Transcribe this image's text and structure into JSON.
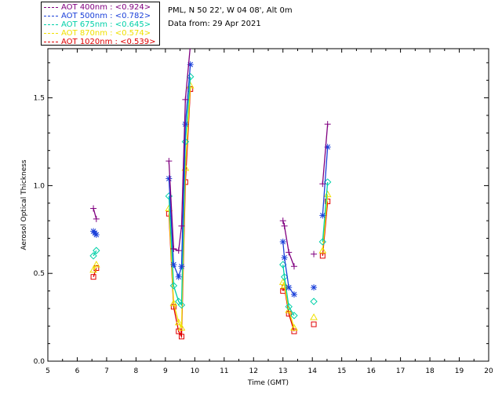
{
  "header": {
    "site": "PML, N 50 22', W 04 08', Alt 0m",
    "date": "Data from: 29 Apr 2021"
  },
  "legend": [
    {
      "label": "AOT  400nm : <0.924>",
      "color": "#800080"
    },
    {
      "label": "AOT  500nm : <0.782>",
      "color": "#1a3fd9"
    },
    {
      "label": "AOT  675nm : <0.645>",
      "color": "#00d0a8"
    },
    {
      "label": "AOT  870nm : <0.574>",
      "color": "#f0e000"
    },
    {
      "label": "AOT 1020nm : <0.539>",
      "color": "#e00000"
    }
  ],
  "chart_data": {
    "type": "line",
    "title": "",
    "xlabel": "Time (GMT)",
    "ylabel": "Aerosol Optical Thickness",
    "xlim": [
      5,
      20
    ],
    "ylim": [
      0,
      1.78
    ],
    "xticks": [
      "5",
      "6",
      "7",
      "8",
      "9",
      "10",
      "11",
      "12",
      "13",
      "14",
      "15",
      "16",
      "17",
      "18",
      "19",
      "20"
    ],
    "yticks": [
      "0.0",
      "0.5",
      "1.0",
      "1.5"
    ],
    "grid": false,
    "series": [
      {
        "name": "AOT  400nm : <0.924>",
        "color": "#800080",
        "marker": "plus",
        "segments": [
          [
            [
              6.55,
              0.87
            ],
            [
              6.65,
              0.81
            ]
          ],
          [
            [
              9.12,
              1.14
            ],
            [
              9.28,
              0.64
            ],
            [
              9.45,
              0.63
            ],
            [
              9.55,
              0.77
            ],
            [
              9.68,
              1.49
            ],
            [
              9.85,
              1.8
            ]
          ],
          [
            [
              13.0,
              0.8
            ],
            [
              13.05,
              0.77
            ],
            [
              13.2,
              0.62
            ],
            [
              13.38,
              0.54
            ]
          ],
          [
            [
              14.05,
              0.61
            ]
          ],
          [
            [
              14.35,
              1.01
            ],
            [
              14.52,
              1.35
            ]
          ]
        ]
      },
      {
        "name": "AOT  500nm : <0.782>",
        "color": "#1a3fd9",
        "marker": "star",
        "segments": [
          [
            [
              6.55,
              0.74
            ],
            [
              6.6,
              0.73
            ],
            [
              6.65,
              0.72
            ]
          ],
          [
            [
              9.12,
              1.04
            ],
            [
              9.28,
              0.55
            ],
            [
              9.45,
              0.48
            ],
            [
              9.55,
              0.54
            ],
            [
              9.68,
              1.35
            ],
            [
              9.85,
              1.69
            ]
          ],
          [
            [
              13.0,
              0.68
            ],
            [
              13.05,
              0.59
            ],
            [
              13.2,
              0.42
            ],
            [
              13.38,
              0.38
            ]
          ],
          [
            [
              14.05,
              0.42
            ]
          ],
          [
            [
              14.35,
              0.83
            ],
            [
              14.52,
              1.22
            ]
          ]
        ]
      },
      {
        "name": "AOT  675nm : <0.645>",
        "color": "#00d0a8",
        "marker": "diamond",
        "segments": [
          [
            [
              6.55,
              0.6
            ],
            [
              6.65,
              0.63
            ]
          ],
          [
            [
              9.12,
              0.94
            ],
            [
              9.28,
              0.43
            ],
            [
              9.45,
              0.34
            ],
            [
              9.55,
              0.32
            ],
            [
              9.68,
              1.25
            ],
            [
              9.85,
              1.62
            ]
          ],
          [
            [
              13.0,
              0.55
            ],
            [
              13.05,
              0.48
            ],
            [
              13.2,
              0.31
            ],
            [
              13.38,
              0.26
            ]
          ],
          [
            [
              14.05,
              0.34
            ]
          ],
          [
            [
              14.35,
              0.68
            ],
            [
              14.52,
              1.02
            ]
          ]
        ]
      },
      {
        "name": "AOT  870nm : <0.574>",
        "color": "#f0e000",
        "marker": "triangle",
        "segments": [
          [
            [
              6.55,
              0.52
            ],
            [
              6.65,
              0.55
            ]
          ],
          [
            [
              9.12,
              0.87
            ],
            [
              9.28,
              0.33
            ],
            [
              9.45,
              0.22
            ],
            [
              9.55,
              0.19
            ],
            [
              9.68,
              1.1
            ],
            [
              9.85,
              1.57
            ]
          ],
          [
            [
              13.0,
              0.45
            ],
            [
              13.05,
              0.43
            ],
            [
              13.2,
              0.29
            ],
            [
              13.38,
              0.19
            ]
          ],
          [
            [
              14.05,
              0.25
            ]
          ],
          [
            [
              14.35,
              0.63
            ],
            [
              14.52,
              0.95
            ]
          ]
        ]
      },
      {
        "name": "AOT 1020nm : <0.539>",
        "color": "#e00000",
        "marker": "square",
        "segments": [
          [
            [
              6.55,
              0.48
            ],
            [
              6.65,
              0.53
            ]
          ],
          [
            [
              9.12,
              0.84
            ],
            [
              9.28,
              0.31
            ],
            [
              9.45,
              0.17
            ],
            [
              9.55,
              0.14
            ],
            [
              9.68,
              1.02
            ],
            [
              9.85,
              1.55
            ]
          ],
          [
            [
              13.0,
              0.4
            ],
            [
              13.05,
              0.42
            ],
            [
              13.2,
              0.27
            ],
            [
              13.38,
              0.17
            ]
          ],
          [
            [
              14.05,
              0.21
            ]
          ],
          [
            [
              14.35,
              0.6
            ],
            [
              14.52,
              0.91
            ]
          ]
        ]
      }
    ]
  }
}
